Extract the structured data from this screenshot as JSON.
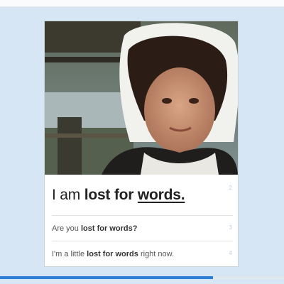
{
  "card": {
    "image_alt": "woman in white lace bonnet",
    "headline": {
      "pre": "I am ",
      "bold": "lost for ",
      "bold_underlined": "words."
    },
    "headline_number": "2",
    "examples": [
      {
        "pre": "Are you ",
        "bold": "lost for words?",
        "post": "",
        "number": "3"
      },
      {
        "pre": "I'm a little ",
        "bold": "lost for words",
        "post": " right now.",
        "number": "4"
      }
    ]
  },
  "progress": {
    "fraction": 0.75
  },
  "colors": {
    "background": "#d6e6f4",
    "progress": "#2f7fd6",
    "card": "#ffffff"
  }
}
